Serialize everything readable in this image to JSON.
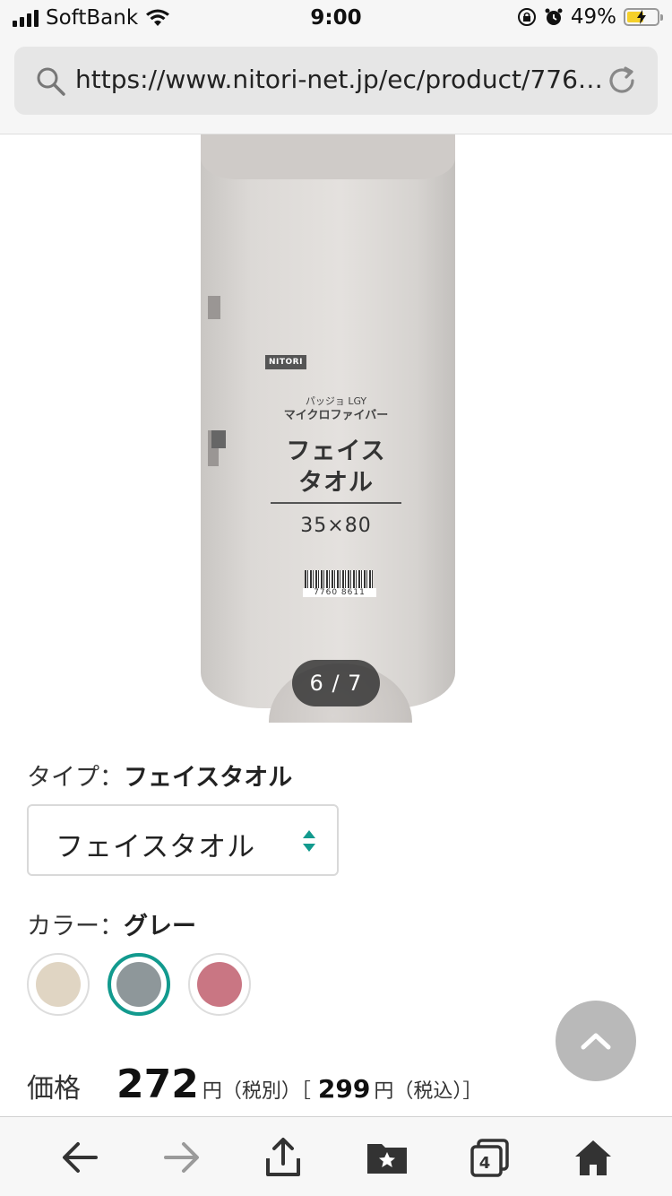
{
  "status_bar": {
    "carrier": "SoftBank",
    "time": "9:00",
    "battery": "49%"
  },
  "browser": {
    "url": "https://www.nitori-net.jp/ec/product/776…"
  },
  "gallery": {
    "counter": "6 / 7",
    "package": {
      "brand": "NITORI",
      "subtitle_line1": "パッジョ LGY",
      "subtitle_line2": "マイクロファイバー",
      "title_line1": "フェイス",
      "title_line2": "タオル",
      "size": "35×80",
      "barcode_number": "7760 8611"
    }
  },
  "type_option": {
    "label": "タイプ：",
    "value": "フェイスタオル",
    "select_value": "フェイスタオル"
  },
  "color_option": {
    "label": "カラー：",
    "value": "グレー",
    "swatches": [
      {
        "color": "#e0d5c3",
        "selected": false
      },
      {
        "color": "#8e979a",
        "selected": true
      },
      {
        "color": "#c97683",
        "selected": false
      }
    ]
  },
  "price": {
    "label": "価格",
    "amount": "272",
    "unit_excl": "円（税別）［",
    "amount_incl": "299",
    "unit_incl": "円（税込）］"
  },
  "toolbar": {
    "tabs_count": "4"
  },
  "colors": {
    "accent": "#129a8e",
    "scroll_top_button": "#b9b9b9"
  }
}
